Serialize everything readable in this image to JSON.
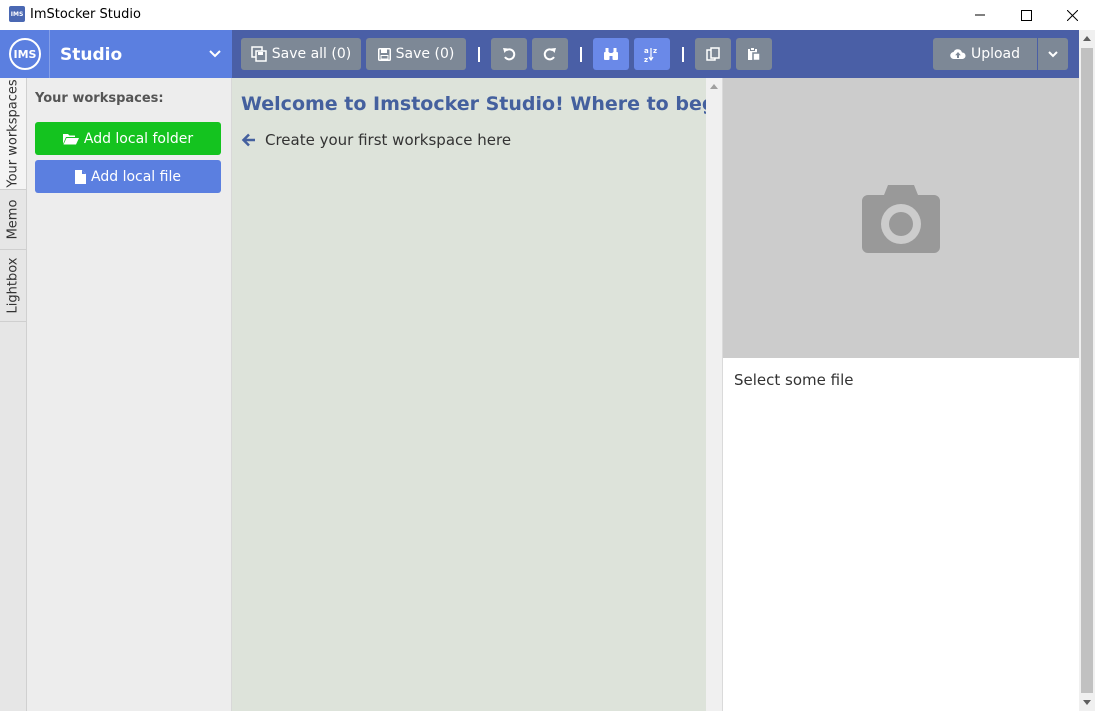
{
  "window": {
    "title": "ImStocker Studio",
    "icon_text": "IMS"
  },
  "appbar": {
    "logo_text": "IMS",
    "brand_name": "Studio",
    "save_all_label": "Save all (0)",
    "save_label": "Save (0)",
    "upload_label": "Upload"
  },
  "vtabs": [
    "Your workspaces",
    "Memo",
    "Lightbox"
  ],
  "workspaces": {
    "title": "Your workspaces:",
    "add_folder_label": "Add local folder",
    "add_file_label": "Add local file"
  },
  "welcome": {
    "title": "Welcome to Imstocker Studio! Where to begin?",
    "hint": "Create your first workspace here"
  },
  "preview": {
    "empty_text": "Select some file"
  },
  "colors": {
    "appbar": "#4a5fa6",
    "brand": "#5b7fe0",
    "green": "#14c31f",
    "welcome_bg": "#dde3da",
    "heading": "#44609e"
  }
}
